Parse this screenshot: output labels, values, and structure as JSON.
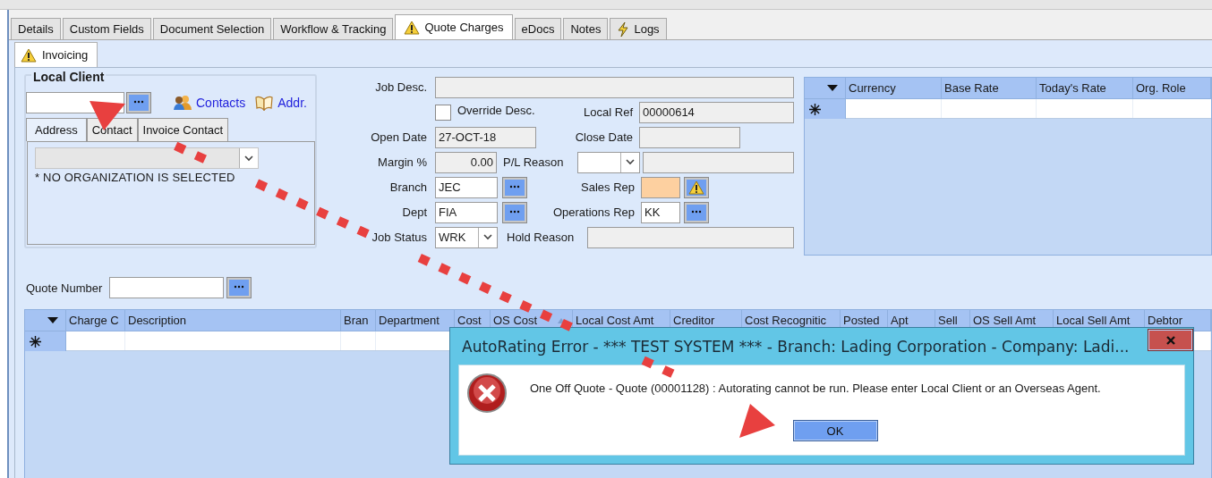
{
  "tabs": [
    {
      "label": "Details",
      "selected": false
    },
    {
      "label": "Custom Fields",
      "selected": false
    },
    {
      "label": "Document Selection",
      "selected": false
    },
    {
      "label": "Workflow & Tracking",
      "selected": false
    },
    {
      "label": "Quote Charges",
      "selected": true
    },
    {
      "label": "eDocs",
      "selected": false
    },
    {
      "label": "Notes",
      "selected": false
    },
    {
      "label": "Logs",
      "selected": false
    }
  ],
  "subtabs": [
    {
      "label": "Invoicing",
      "selected": true
    }
  ],
  "local_client": {
    "title": "Local Client",
    "links": [
      {
        "label": "Contacts"
      },
      {
        "label": "Addr."
      }
    ],
    "tabs": [
      {
        "label": "Address",
        "selected": true
      },
      {
        "label": "Contact",
        "selected": false
      },
      {
        "label": "Invoice Contact",
        "selected": false
      }
    ],
    "notice": "* NO ORGANIZATION IS SELECTED"
  },
  "form": {
    "job_desc": {
      "label": "Job Desc."
    },
    "override_desc": {
      "label": "Override Desc.",
      "checked": false
    },
    "local_ref": {
      "label": "Local Ref",
      "value": "00000614"
    },
    "open_date": {
      "label": "Open Date",
      "value": "27-OCT-18"
    },
    "close_date": {
      "label": "Close Date"
    },
    "margin": {
      "label": "Margin %",
      "value": "0.00"
    },
    "pl_reason": {
      "label": "P/L Reason"
    },
    "branch": {
      "label": "Branch",
      "value": "JEC"
    },
    "sales_rep": {
      "label": "Sales Rep",
      "warning": true
    },
    "dept": {
      "label": "Dept",
      "value": "FIA"
    },
    "operations_rep": {
      "label": "Operations Rep",
      "value": "KK",
      "warning": false
    },
    "job_status": {
      "label": "Job Status",
      "value": "WRK"
    },
    "hold_reason": {
      "label": "Hold Reason"
    }
  },
  "rates_grid": {
    "columns": [
      {
        "label": "Currency",
        "sorted": false
      },
      {
        "label": "Base Rate",
        "sorted": false
      },
      {
        "label": "Today's Rate",
        "sorted": false
      },
      {
        "label": "Org. Role",
        "sorted": false
      }
    ]
  },
  "quote_number": {
    "label": "Quote Number"
  },
  "charges_grid": {
    "columns": [
      {
        "label": "Charge C",
        "sorted": false
      },
      {
        "label": "Description",
        "sorted": false
      },
      {
        "label": "Bran",
        "sorted": false
      },
      {
        "label": "Department",
        "sorted": false
      },
      {
        "label": "Cost",
        "sorted": false
      },
      {
        "label": "OS Cost",
        "sorted": true
      },
      {
        "label": "Local Cost Amt",
        "sorted": false
      },
      {
        "label": "Creditor",
        "sorted": false
      },
      {
        "label": "Cost Recognitic",
        "sorted": false
      },
      {
        "label": "Posted",
        "sorted": false
      },
      {
        "label": "Apt",
        "sorted": false
      },
      {
        "label": "Sell",
        "sorted": false
      },
      {
        "label": "OS Sell Amt",
        "sorted": false
      },
      {
        "label": "Local Sell Amt",
        "sorted": false
      },
      {
        "label": "Debtor",
        "sorted": false
      }
    ]
  },
  "dialog": {
    "title": "AutoRating Error - *** TEST SYSTEM *** - Branch: Lading Corporation - Company: Ladi...",
    "message": "One Off Quote - Quote (00001128) : Autorating cannot be run. Please enter Local Client or an Overseas Agent.",
    "buttons": [
      "OK"
    ]
  }
}
